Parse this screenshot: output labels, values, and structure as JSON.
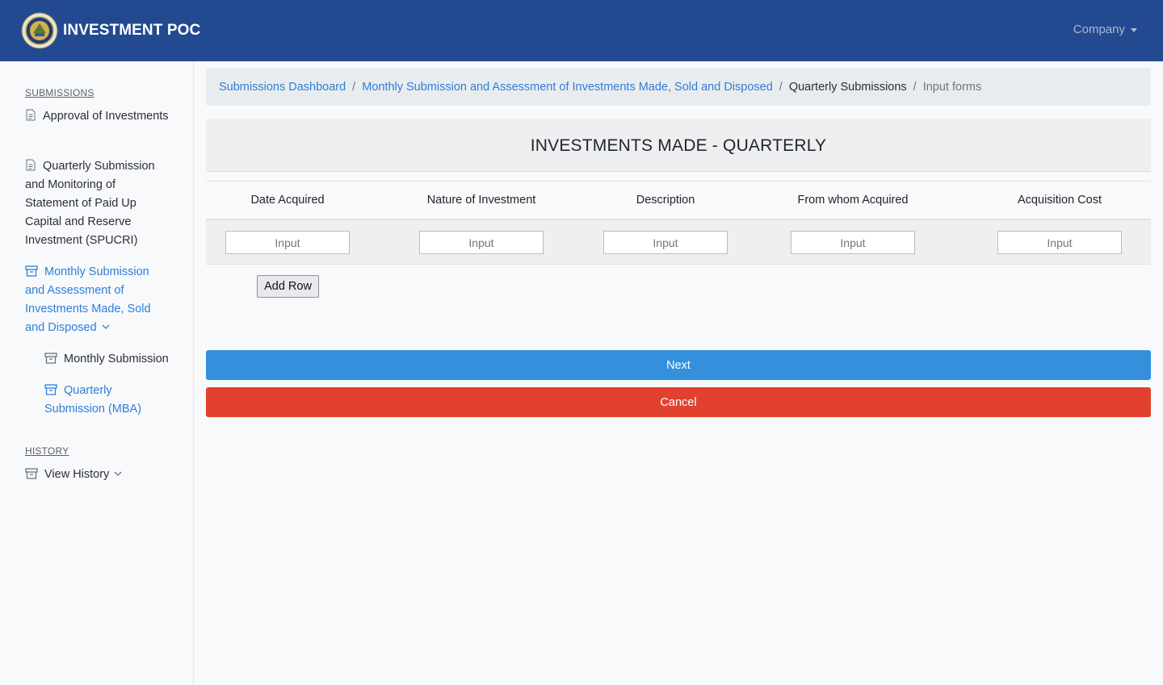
{
  "header": {
    "brand": "INVESTMENT POC",
    "company_menu": "Company"
  },
  "sidebar": {
    "submissions_heading": "SUBMISSIONS",
    "items": [
      {
        "label": "Approval of Investments",
        "icon": "document-icon"
      },
      {
        "label": "Quarterly Submission and Monitoring of Statement of Paid Up Capital and Reserve Investment (SPUCRI)",
        "icon": "document-icon"
      },
      {
        "label": "Monthly Submission and Assessment of Investments Made, Sold and Disposed",
        "icon": "archive-icon",
        "active": true
      },
      {
        "label": "Monthly Submission",
        "icon": "archive-icon"
      },
      {
        "label": "Quarterly Submission (MBA)",
        "icon": "archive-icon",
        "active": true
      }
    ],
    "history_heading": "HISTORY",
    "history_items": [
      {
        "label": "View History",
        "icon": "archive-icon"
      }
    ]
  },
  "breadcrumb": {
    "items": [
      "Submissions Dashboard",
      "Monthly Submission and Assessment of Investments Made, Sold and Disposed",
      "Quarterly Submissions",
      "Input forms"
    ]
  },
  "form": {
    "title": "INVESTMENTS MADE - QUARTERLY",
    "columns": [
      "Date Acquired",
      "Nature of Investment",
      "Description",
      "From whom Acquired",
      "Acquisition Cost"
    ],
    "row_placeholders": [
      "Input",
      "Input",
      "Input",
      "Input",
      "Input"
    ],
    "add_row_label": "Add Row",
    "next_label": "Next",
    "cancel_label": "Cancel"
  },
  "colors": {
    "navbar": "#234990",
    "link": "#2f7ed8",
    "next": "#3490dc",
    "cancel": "#e3412f"
  }
}
